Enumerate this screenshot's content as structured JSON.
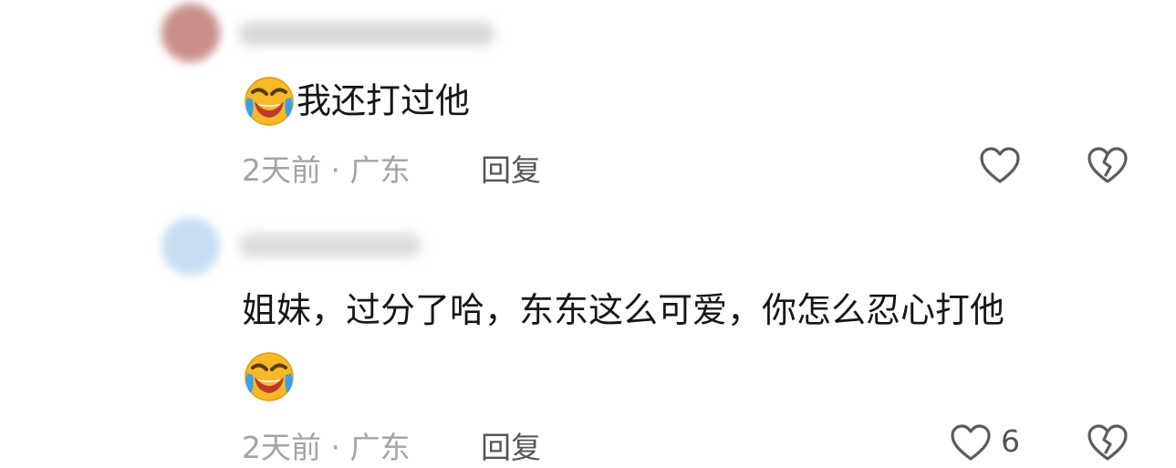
{
  "comments": [
    {
      "text": "我还打过他",
      "emoji": "crying-laughing-emoji",
      "time_location": "2天前 · 广东",
      "reply_label": "回复",
      "like_count": "",
      "avatar_color": "#c98f8a"
    },
    {
      "text": "姐妹，过分了哈，东东这么可爱，你怎么忍心打他",
      "emoji": "crying-laughing-emoji",
      "time_location": "2天前 · 广东",
      "reply_label": "回复",
      "like_count": "6",
      "avatar_color": "#c7def2"
    }
  ],
  "icons": {
    "like": "heart-outline-icon",
    "dislike": "broken-heart-icon"
  }
}
